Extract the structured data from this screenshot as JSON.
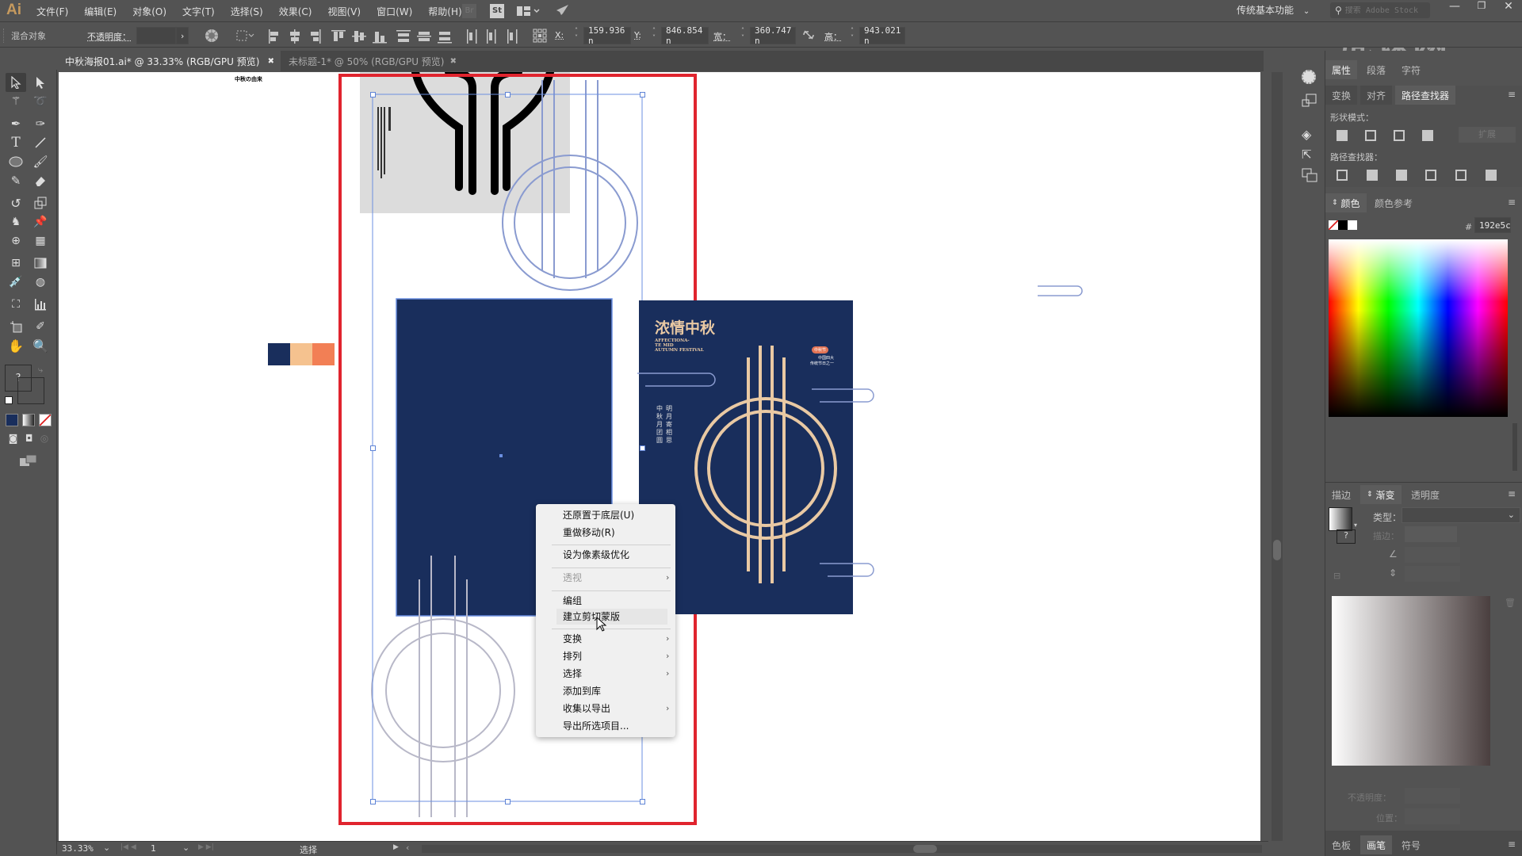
{
  "app": {
    "logo": "Ai"
  },
  "menubar": {
    "items": [
      "文件(F)",
      "编辑(E)",
      "对象(O)",
      "文字(T)",
      "选择(S)",
      "效果(C)",
      "视图(V)",
      "窗口(W)",
      "帮助(H)"
    ],
    "bridge_label": "Br",
    "stock_label": "St",
    "workspace": "传统基本功能",
    "search_placeholder": "搜索 Adobe Stock",
    "watermark": "虎课网"
  },
  "control_bar": {
    "selection_type": "混合对象",
    "opacity_label": "不透明度：",
    "opacity_value": "",
    "x_label": "X:",
    "x_value": "159.936 n",
    "y_label": "Y:",
    "y_value": "846.854 n",
    "w_label": "宽：",
    "w_value": "360.747 n",
    "h_label": "高：",
    "h_value": "943.021 n"
  },
  "document_tabs": [
    {
      "label": "中秋海报01.ai* @ 33.33% (RGB/GPU 预览)",
      "active": true
    },
    {
      "label": "未标题-1* @ 50% (RGB/GPU 预览)",
      "active": false
    }
  ],
  "artboard": {
    "small_title": "中秋の由来",
    "swatches": [
      "#192e5c",
      "#f5c28f",
      "#f27f55"
    ],
    "poster_title": "浓情中秋",
    "poster_subtitle_en": [
      "AFFECTIONA-",
      "TE MID",
      "AUTUMN FESTIVAL"
    ],
    "poster_badge": "中秋节",
    "poster_side_text": [
      "中国四大",
      "传统节日之一"
    ],
    "poster_vertical_left": [
      "中",
      "秋",
      "月",
      "团",
      "圆"
    ],
    "poster_vertical_right": [
      "明",
      "月",
      "寄",
      "相",
      "思"
    ],
    "navy": "#192e5c",
    "cream": "#e9c9a3",
    "artboard_border": "#e0242e"
  },
  "context_menu": {
    "items": [
      {
        "label": "还原置于底层(U)",
        "disabled": false,
        "submenu": false
      },
      {
        "label": "重做移动(R)",
        "disabled": false,
        "submenu": false
      },
      {
        "label": "设为像素级优化",
        "disabled": false,
        "submenu": false
      },
      {
        "label": "透视",
        "disabled": true,
        "submenu": true
      },
      {
        "label": "编组",
        "disabled": false,
        "submenu": false
      },
      {
        "label": "建立剪切蒙版",
        "disabled": false,
        "submenu": false,
        "hovered": true
      },
      {
        "label": "变换",
        "disabled": false,
        "submenu": true
      },
      {
        "label": "排列",
        "disabled": false,
        "submenu": true
      },
      {
        "label": "选择",
        "disabled": false,
        "submenu": true
      },
      {
        "label": "添加到库",
        "disabled": false,
        "submenu": false
      },
      {
        "label": "收集以导出",
        "disabled": false,
        "submenu": true
      },
      {
        "label": "导出所选项目...",
        "disabled": false,
        "submenu": false
      }
    ]
  },
  "status_bar": {
    "zoom": "33.33%",
    "artboard_number": "1",
    "tool_status": "选择"
  },
  "panel": {
    "top_tabs": [
      "属性",
      "段落",
      "字符"
    ],
    "sub_tabs": [
      "变换",
      "对齐",
      "路径查找器"
    ],
    "shape_modes_label": "形状模式：",
    "expand_label": "扩展",
    "pathfinders_label": "路径查找器：",
    "color_tabs": [
      "颜色",
      "颜色参考"
    ],
    "hex_label": "#",
    "hex_value": "192e5c",
    "gradient_tabs": [
      "描边",
      "渐变",
      "透明度"
    ],
    "type_label": "类型：",
    "stroke_label": "描边：",
    "opacity_label": "不透明度：",
    "location_label": "位置：",
    "bottom_tabs": [
      "色板",
      "画笔",
      "符号"
    ]
  }
}
